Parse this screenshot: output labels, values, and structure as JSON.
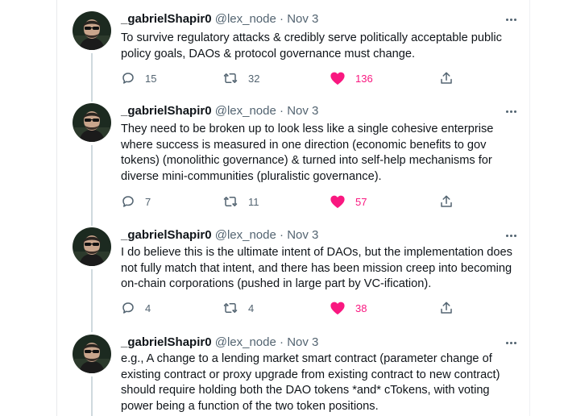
{
  "tweets": [
    {
      "name": "_gabrielShapir0",
      "handle": "@lex_node",
      "separator": "·",
      "date": "Nov 3",
      "lines": [
        "To survive regulatory attacks & credibly serve politically acceptable public",
        "policy goals, DAOs & protocol governance must change."
      ],
      "replies": "15",
      "retweets": "32",
      "likes": "136"
    },
    {
      "name": "_gabrielShapir0",
      "handle": "@lex_node",
      "separator": "·",
      "date": "Nov 3",
      "lines": [
        "They need to be broken up to look less like a single cohesive enterprise",
        "where success is measured in one direction (economic benefits to gov",
        "tokens) (monolithic governance) & turned into self-help mechanisms for",
        "diverse mini-communities (pluralistic governance)."
      ],
      "replies": "7",
      "retweets": "11",
      "likes": "57"
    },
    {
      "name": "_gabrielShapir0",
      "handle": "@lex_node",
      "separator": "·",
      "date": "Nov 3",
      "lines": [
        "I do believe this is the ultimate intent of DAOs, but the implementation does",
        "not fully match that intent, and there has been mission creep into becoming",
        "on-chain corporations (pushed in large part by VC-ification)."
      ],
      "replies": "4",
      "retweets": "4",
      "likes": "38"
    },
    {
      "name": "_gabrielShapir0",
      "handle": "@lex_node",
      "separator": "·",
      "date": "Nov 3",
      "lines": [
        "e.g., A change to a lending market smart contract (parameter change of",
        "existing contract or proxy upgrade from existing contract to new contract)",
        "should require holding both the DAO tokens *and* cTokens, with voting",
        "power being a function of the two token positions."
      ]
    }
  ],
  "icons": {
    "reply": "reply-icon",
    "retweet": "retweet-icon",
    "like": "heart-icon",
    "share": "share-icon",
    "more": "more-icon"
  },
  "colors": {
    "text": "#0f1419",
    "secondary": "#536471",
    "like": "#f91880",
    "thread_line": "#cfd9de"
  }
}
